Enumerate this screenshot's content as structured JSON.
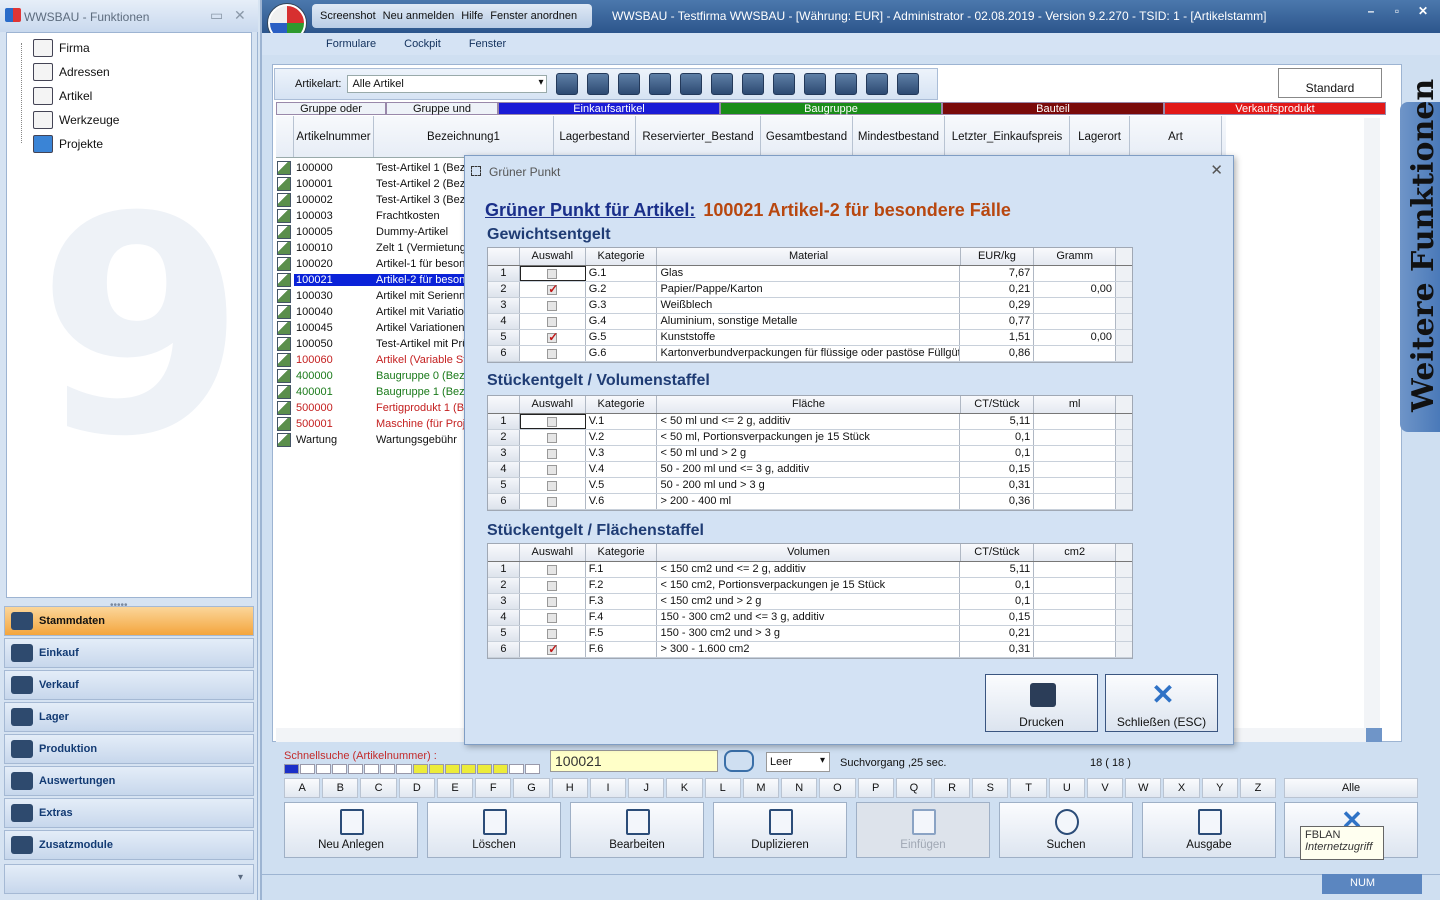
{
  "left": {
    "title": "WWSBAU - Funktionen",
    "tree": [
      "Firma",
      "Adressen",
      "Artikel",
      "Werkzeuge",
      "Projekte"
    ],
    "modules": [
      "Stammdaten",
      "Einkauf",
      "Verkauf",
      "Lager",
      "Produktion",
      "Auswertungen",
      "Extras",
      "Zusatzmodule"
    ]
  },
  "main": {
    "quickmenu": [
      "Screenshot",
      "Neu anmelden",
      "Hilfe",
      "Fenster anordnen"
    ],
    "title": "WWSBAU - Testfirma WWSBAU - [Währung: EUR] - Administrator - 02.08.2019 - Version 9.2.270 - TSID: 1 - [Artikelstamm]",
    "menu": [
      "Formulare",
      "Cockpit",
      "Fenster"
    ],
    "toolbar": {
      "label": "Artikelart:",
      "value": "Alle Artikel"
    },
    "standard": "Standard",
    "legend": [
      {
        "label": "Gruppe oder",
        "color": "#eef2f8",
        "text": "#111"
      },
      {
        "label": "Gruppe und",
        "color": "#eef2f8",
        "text": "#111"
      },
      {
        "label": "Einkaufsartikel",
        "color": "#1b1bd6",
        "text": "#fff"
      },
      {
        "label": "Baugruppe",
        "color": "#1a8c1a",
        "text": "#fff"
      },
      {
        "label": "Bauteil",
        "color": "#7a0a0a",
        "text": "#fff"
      },
      {
        "label": "Verkaufsprodukt",
        "color": "#e21818",
        "text": "#fff"
      }
    ],
    "columns": [
      "Artikelnummer",
      "Bezeichnung1",
      "Lagerbestand",
      "Reservierter_Bestand",
      "Gesamtbestand",
      "Mindestbestand",
      "Letzter_Einkaufspreis",
      "Lagerort",
      "Art"
    ],
    "rows": [
      {
        "nr": "100000",
        "bz": "Test-Artikel 1 (Bez",
        "c": ""
      },
      {
        "nr": "100001",
        "bz": "Test-Artikel 2 (Bez",
        "c": ""
      },
      {
        "nr": "100002",
        "bz": "Test-Artikel 3 (Bez",
        "c": ""
      },
      {
        "nr": "100003",
        "bz": "Frachtkosten",
        "c": ""
      },
      {
        "nr": "100005",
        "bz": "Dummy-Artikel",
        "c": ""
      },
      {
        "nr": "100010",
        "bz": "Zelt 1 (Vermietung)",
        "c": ""
      },
      {
        "nr": "100020",
        "bz": "Artikel-1 für besonde",
        "c": ""
      },
      {
        "nr": "100021",
        "bz": "Artikel-2 für besonde",
        "c": "sel"
      },
      {
        "nr": "100030",
        "bz": "Artikel mit Seriennu",
        "c": ""
      },
      {
        "nr": "100040",
        "bz": "Artikel mit Variation",
        "c": ""
      },
      {
        "nr": "100045",
        "bz": "Artikel Variationen",
        "c": ""
      },
      {
        "nr": "100050",
        "bz": "Test-Artikel mit Prü",
        "c": ""
      },
      {
        "nr": "100060",
        "bz": "Artikel (Variable St",
        "c": "red"
      },
      {
        "nr": "400000",
        "bz": "Baugruppe 0 (Bez",
        "c": "green"
      },
      {
        "nr": "400001",
        "bz": "Baugruppe 1 (Bez",
        "c": "green"
      },
      {
        "nr": "500000",
        "bz": "Fertigprodukt 1 (B",
        "c": "red"
      },
      {
        "nr": "500001",
        "bz": "Maschine (für Proje",
        "c": "red"
      },
      {
        "nr": "Wartung",
        "bz": "Wartungsgebühr",
        "c": ""
      }
    ],
    "weitere": "Weitere Funktionen",
    "search": {
      "label": "Schnellsuche (Artikelnummer) :",
      "value": "100021",
      "mode": "Leer",
      "time": "Suchvorgang ,25 sec.",
      "count": "18 ( 18 )"
    },
    "alphabet": [
      "A",
      "B",
      "C",
      "D",
      "E",
      "F",
      "G",
      "H",
      "I",
      "J",
      "K",
      "L",
      "M",
      "N",
      "O",
      "P",
      "Q",
      "R",
      "S",
      "T",
      "U",
      "V",
      "W",
      "X",
      "Y",
      "Z"
    ],
    "alle": "Alle",
    "buttons": [
      "Neu Anlegen",
      "Löschen",
      "Bearbeiten",
      "Duplizieren",
      "Einfügen",
      "Suchen",
      "Ausgabe"
    ],
    "tooltip": {
      "line1": "FBLAN",
      "line2": "Internetzugriff"
    },
    "num": "NUM"
  },
  "dialog": {
    "title": "Grüner Punkt",
    "head_label": "Grüner Punkt für Artikel:",
    "head_article": "100021  Artikel-2 für besondere Fälle",
    "sections": [
      {
        "title": "Gewichtsentgelt",
        "cols": [
          "Auswahl",
          "Kategorie",
          "Material",
          "EUR/kg",
          "Gramm"
        ],
        "rows": [
          [
            "1",
            "",
            "G.1",
            "Glas",
            "7,67",
            ""
          ],
          [
            "2",
            "x",
            "G.2",
            "Papier/Pappe/Karton",
            "0,21",
            "0,00"
          ],
          [
            "3",
            "",
            "G.3",
            "Weißblech",
            "0,29",
            ""
          ],
          [
            "4",
            "",
            "G.4",
            "Aluminium, sonstige Metalle",
            "0,77",
            ""
          ],
          [
            "5",
            "x",
            "G.5",
            "Kunststoffe",
            "1,51",
            "0,00"
          ],
          [
            "6",
            "",
            "G.6",
            "Kartonverbundverpackungen für flüssige oder pastöse Füllgüter",
            "0,86",
            ""
          ]
        ]
      },
      {
        "title": "Stückentgelt / Volumenstaffel",
        "cols": [
          "Auswahl",
          "Kategorie",
          "Fläche",
          "CT/Stück",
          "ml"
        ],
        "rows": [
          [
            "1",
            "",
            "V.1",
            "< 50 ml und <= 2 g, additiv",
            "5,11",
            ""
          ],
          [
            "2",
            "",
            "V.2",
            "< 50 ml, Portionsverpackungen je 15 Stück",
            "0,1",
            ""
          ],
          [
            "3",
            "",
            "V.3",
            "< 50 ml und > 2 g",
            "0,1",
            ""
          ],
          [
            "4",
            "",
            "V.4",
            "50 - 200 ml und <= 3 g, additiv",
            "0,15",
            ""
          ],
          [
            "5",
            "",
            "V.5",
            "50 - 200 ml und > 3 g",
            "0,31",
            ""
          ],
          [
            "6",
            "",
            "V.6",
            "> 200 - 400 ml",
            "0,36",
            ""
          ]
        ]
      },
      {
        "title": "Stückentgelt / Flächenstaffel",
        "cols": [
          "Auswahl",
          "Kategorie",
          "Volumen",
          "CT/Stück",
          "cm2"
        ],
        "rows": [
          [
            "1",
            "",
            "F.1",
            "< 150 cm2 und <= 2 g, additiv",
            "5,11",
            ""
          ],
          [
            "2",
            "",
            "F.2",
            "< 150 cm2, Portionsverpackungen je 15 Stück",
            "0,1",
            ""
          ],
          [
            "3",
            "",
            "F.3",
            "< 150 cm2 und > 2 g",
            "0,1",
            ""
          ],
          [
            "4",
            "",
            "F.4",
            "150 - 300 cm2 und <= 3 g, additiv",
            "0,15",
            ""
          ],
          [
            "5",
            "",
            "F.5",
            "150 - 300 cm2 und > 3 g",
            "0,21",
            ""
          ],
          [
            "6",
            "x",
            "F.6",
            "> 300 - 1.600 cm2",
            "0,31",
            ""
          ]
        ]
      }
    ],
    "print": "Drucken",
    "close": "Schließen (ESC)"
  }
}
